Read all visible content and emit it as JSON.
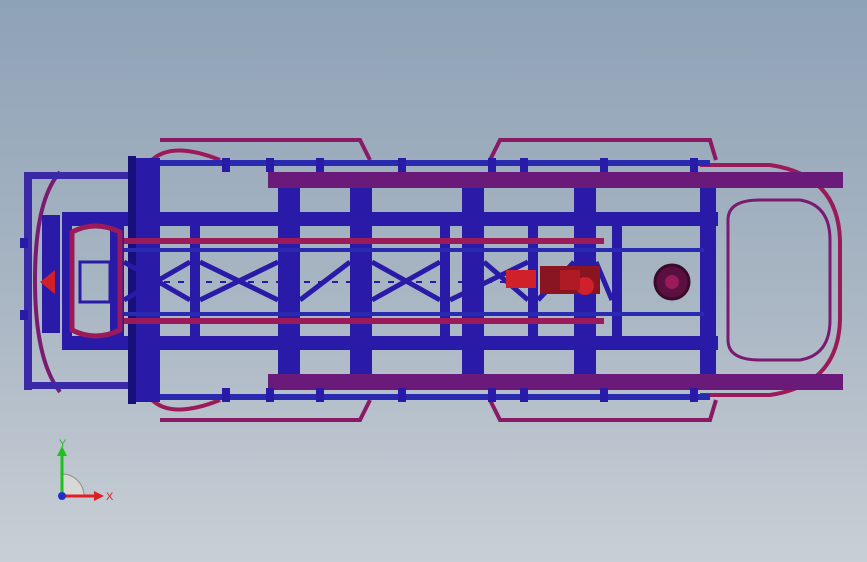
{
  "viewport": {
    "model": "chassis-frame-top-view"
  },
  "triad": {
    "x_label": "X",
    "y_label": "Y",
    "x_color": "#e02020",
    "y_color": "#20c020",
    "z_color": "#2030d0"
  },
  "colors": {
    "background_top": "#8ea2b6",
    "background_bottom": "#c9cfd6",
    "frame_blue": "#2a1aa8",
    "frame_blue_dark": "#17107a",
    "rail_purple": "#6a1a78",
    "rail_magenta": "#9a1a5a",
    "motor_red": "#d0202a"
  }
}
